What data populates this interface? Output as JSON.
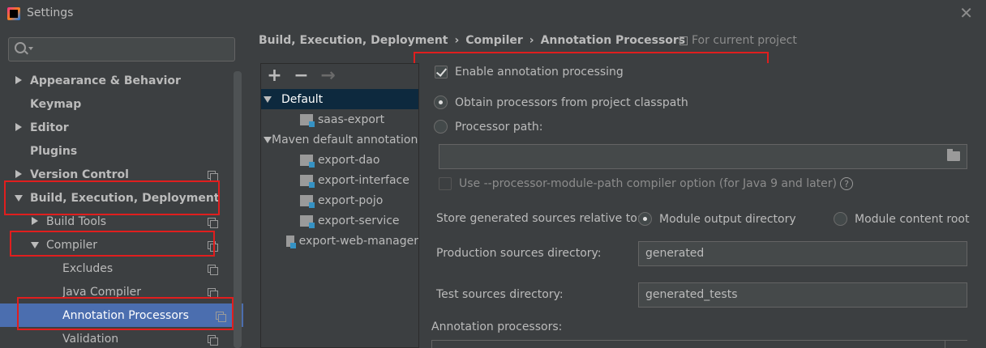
{
  "window": {
    "title": "Settings",
    "close": "✕"
  },
  "search": {
    "placeholder": "",
    "value": ""
  },
  "sidebar": {
    "items": [
      {
        "label": "Appearance & Behavior"
      },
      {
        "label": "Keymap"
      },
      {
        "label": "Editor"
      },
      {
        "label": "Plugins"
      },
      {
        "label": "Version Control"
      },
      {
        "label": "Build, Execution, Deployment"
      },
      {
        "label": "Build Tools"
      },
      {
        "label": "Compiler"
      },
      {
        "label": "Excludes"
      },
      {
        "label": "Java Compiler"
      },
      {
        "label": "Annotation Processors"
      },
      {
        "label": "Validation"
      }
    ]
  },
  "breadcrumb": {
    "items": [
      "Build, Execution, Deployment",
      "Compiler",
      "Annotation Processors"
    ],
    "separator": "›",
    "scope": "For current project"
  },
  "toolbar": {
    "add": "+",
    "remove": "−",
    "move": "→"
  },
  "profiles": [
    {
      "label": "Default"
    },
    {
      "label": "saas-export"
    },
    {
      "label": "Maven default annotation processors profile"
    },
    {
      "label": "export-dao"
    },
    {
      "label": "export-interface"
    },
    {
      "label": "export-pojo"
    },
    {
      "label": "export-service"
    },
    {
      "label": "export-web-manager"
    }
  ],
  "form": {
    "enable_annotation": "Enable annotation processing",
    "enable_checked": true,
    "obtain_from_classpath": "Obtain processors from project classpath",
    "processor_path": "Processor path:",
    "processor_path_value": "",
    "module_path_option": "Use --processor-module-path compiler option (for Java 9 and later)",
    "store_relative_label": "Store generated sources relative to:",
    "module_output_dir": "Module output directory",
    "module_content_root": "Module content root",
    "production_sources_label": "Production sources directory:",
    "production_sources_value": "generated",
    "test_sources_label": "Test sources directory:",
    "test_sources_value": "generated_tests",
    "annotation_processors_label": "Annotation processors:"
  },
  "colors": {
    "background": "#3c3f41",
    "selection": "#4b6eaf",
    "highlight": "#e01e1e"
  }
}
